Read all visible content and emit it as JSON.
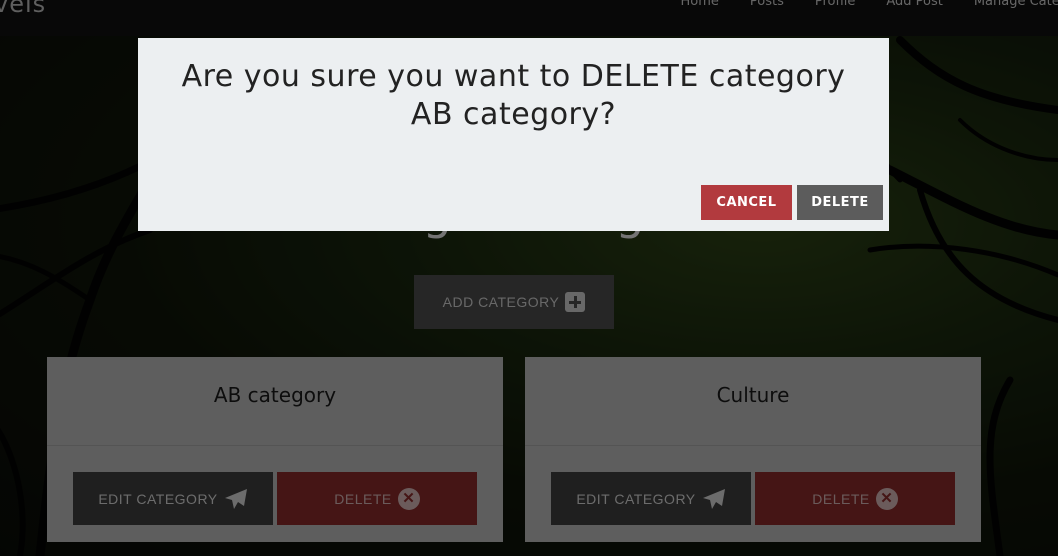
{
  "navbar": {
    "brand": "vels",
    "links": [
      "Home",
      "Posts",
      "Profile",
      "Add Post",
      "Manage Categ"
    ]
  },
  "page": {
    "heading": "Manage Categories",
    "add_button_label": "ADD CATEGORY"
  },
  "categories": [
    {
      "title": "AB category",
      "edit_label": "EDIT CATEGORY",
      "delete_label": "DELETE"
    },
    {
      "title": "Culture",
      "edit_label": "EDIT CATEGORY",
      "delete_label": "DELETE"
    }
  ],
  "modal": {
    "message": "Are you sure you want to DELETE category AB category?",
    "cancel_label": "CANCEL",
    "delete_label": "DELETE"
  },
  "icons": {
    "add": "plus-square-icon",
    "edit": "paper-plane-icon",
    "delete": "times-circle-icon"
  },
  "colors": {
    "cancel": "#b23a3e",
    "delete_card": "#8a2b2b",
    "modal_bg": "#eceff1"
  }
}
